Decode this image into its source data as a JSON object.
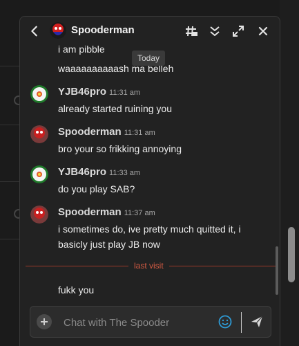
{
  "chat": {
    "title": "Spooderman",
    "tooltip": "Today",
    "messages_partial": [
      {
        "text": "i am pibble"
      },
      {
        "text": "waaaaaaaaaash ma belleh"
      }
    ],
    "messages": [
      {
        "user": "YJB46pro",
        "time": "11:31 am",
        "text": "already started ruining you"
      },
      {
        "user": "Spooderman",
        "time": "11:31 am",
        "text": "bro your so frikking annoying"
      },
      {
        "user": "YJB46pro",
        "time": "11:33 am",
        "text": "do you play SAB?"
      },
      {
        "user": "Spooderman",
        "time": "11:37 am",
        "text": "i sometimes do, ive pretty much quitted it, i basicly just play JB now"
      }
    ],
    "divider_label": "last visit",
    "last_message": "fukk you",
    "input_placeholder": "Chat with The Spooder"
  },
  "colors": {
    "accent_emoji": "#2e9bd6",
    "divider": "#d25a42",
    "panel": "#222222"
  },
  "icons": [
    "back-arrow-icon",
    "thread-icon",
    "collapse-icon",
    "expand-icon",
    "close-icon",
    "plus-icon",
    "emoji-icon",
    "send-icon"
  ]
}
